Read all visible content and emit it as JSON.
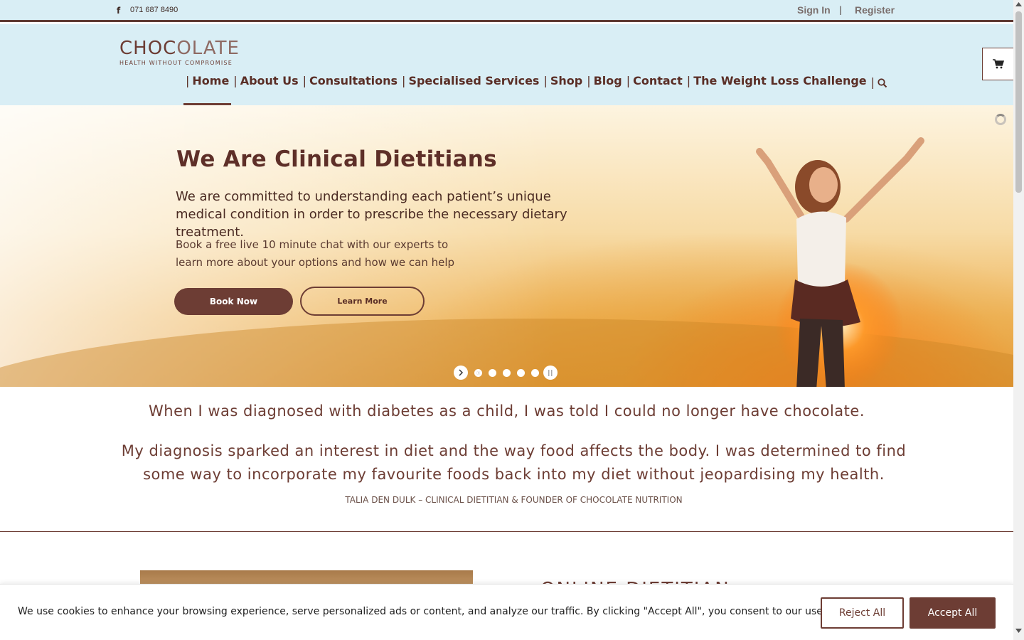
{
  "topbar": {
    "facebook_icon": "f",
    "phone": "071 687 8490",
    "sign_in": "Sign In",
    "separator": "|",
    "register": "Register"
  },
  "logo": {
    "main_dark": "CHOC",
    "main_light": "OLATE",
    "tagline": "HEALTH WITHOUT COMPROMISE"
  },
  "nav": {
    "bar": "|",
    "items": [
      {
        "label": "Home",
        "active": true
      },
      {
        "label": "About Us"
      },
      {
        "label": "Consultations"
      },
      {
        "label": "Specialised Services"
      },
      {
        "label": "Shop"
      },
      {
        "label": "Blog"
      },
      {
        "label": "Contact"
      },
      {
        "label": "The Weight Loss Challenge"
      }
    ],
    "search_icon": "search-icon",
    "cart_icon": "cart-icon"
  },
  "hero": {
    "title": "We Are Clinical Dietitians",
    "subtitle": "We are committed to understanding each patient’s unique medical condition in order to prescribe the necessary dietary treatment.",
    "small_text": "Book a free live 10 minute chat with our experts to learn more about your options and how we can help",
    "book_button": "Book Now",
    "learn_button": "Learn More",
    "slides_count": 5,
    "active_slide": 1
  },
  "quote": {
    "line1": "When I was diagnosed with diabetes as a child, I was told I could no longer have chocolate.",
    "line2": "My diagnosis sparked an interest in diet and the way food affects the body. I was determined to find some way to incorporate my favourite foods back into my diet without jeopardising my health.",
    "author": "TALIA DEN DULK – CLINICAL DIETITIAN & FOUNDER  OF CHOCOLATE NUTRITION"
  },
  "lower": {
    "heading": "ONLINE DIETITIAN"
  },
  "cookie": {
    "text": "We use cookies to enhance your browsing experience, serve personalized ads or content, and analyze our traffic. By clicking \"Accept All\", you consent to our use of cookies.",
    "reject": "Reject All",
    "accept": "Accept All"
  },
  "colors": {
    "brand": "#6d3d34",
    "header_bg": "#d9eef5"
  }
}
